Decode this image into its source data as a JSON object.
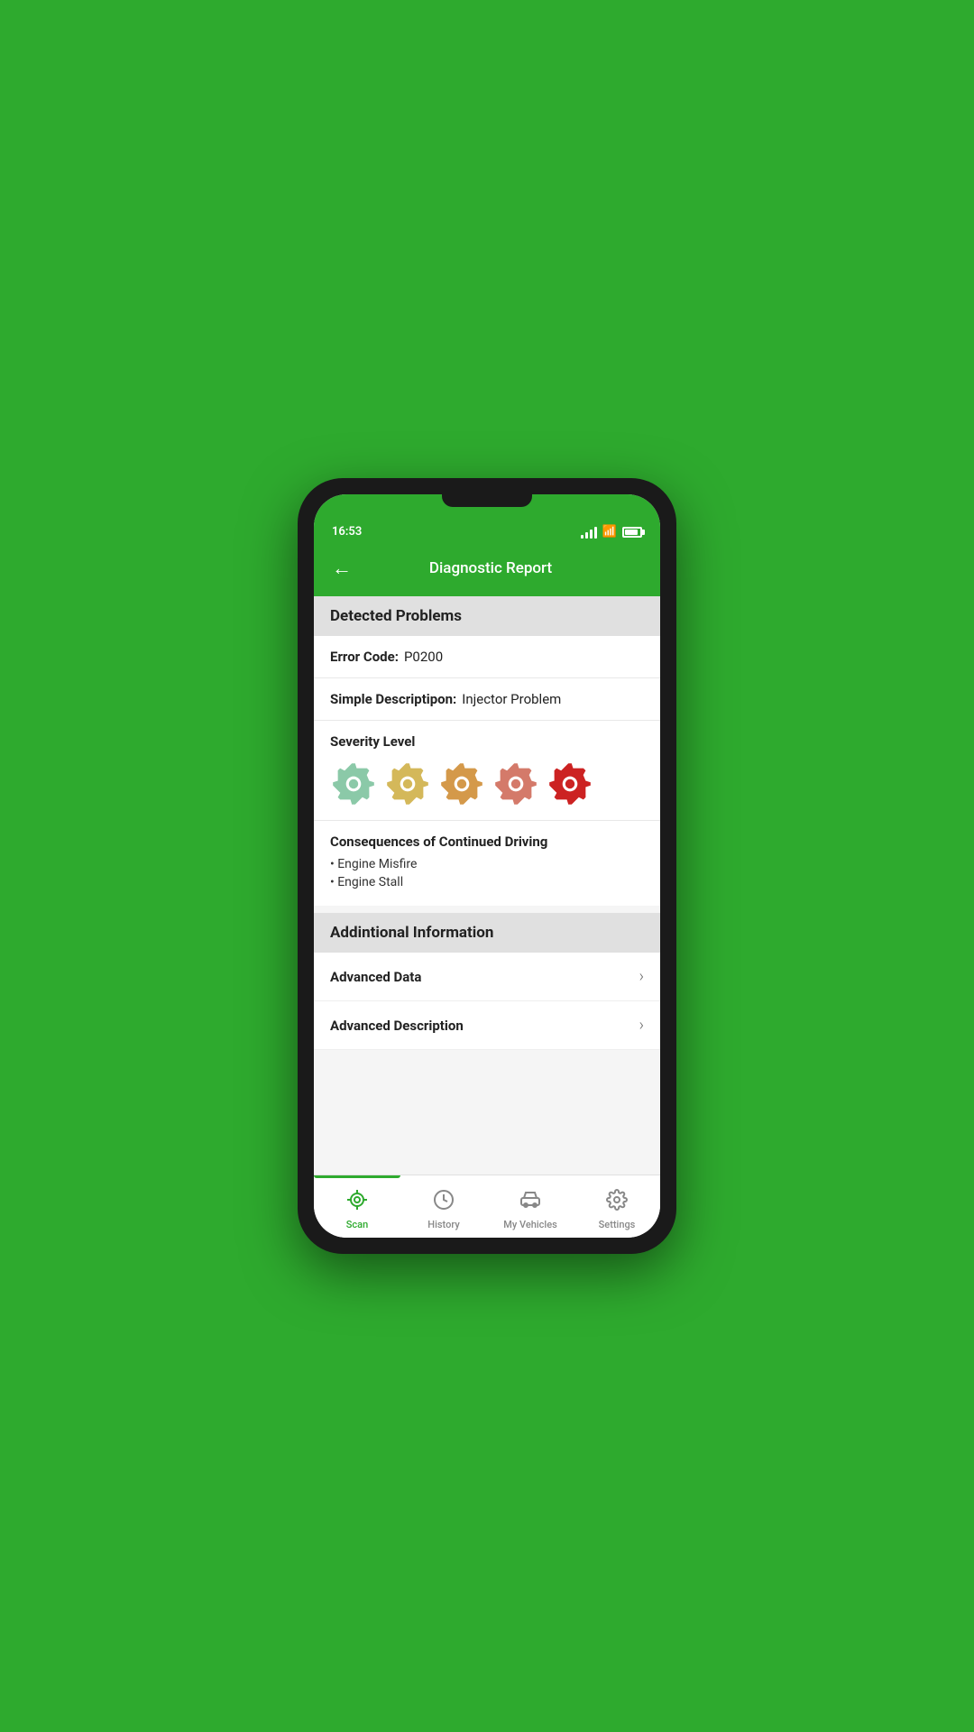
{
  "status_bar": {
    "time": "16:53",
    "signal_bars": [
      4,
      7,
      10,
      13,
      15
    ],
    "battery_level": 85
  },
  "header": {
    "title": "Diagnostic Report",
    "back_label": "←"
  },
  "detected_problems": {
    "section_title": "Detected Problems",
    "error_code_label": "Error Code:",
    "error_code_value": "P0200",
    "simple_desc_label": "Simple Descriptipon:",
    "simple_desc_value": "Injector Problem",
    "severity_label": "Severity Level",
    "severity_levels": [
      {
        "color": "#8bc9a8",
        "active": false
      },
      {
        "color": "#d4b85a",
        "active": false
      },
      {
        "color": "#d4994a",
        "active": false
      },
      {
        "color": "#d47a6a",
        "active": false
      },
      {
        "color": "#cc2222",
        "active": true
      }
    ],
    "consequences_title": "Consequences of Continued Driving",
    "consequences": [
      "Engine Misfire",
      "Engine Stall"
    ]
  },
  "additional_information": {
    "section_title": "Addintional Information",
    "items": [
      {
        "label": "Advanced Data",
        "id": "advanced-data"
      },
      {
        "label": "Advanced Description",
        "id": "advanced-description"
      }
    ]
  },
  "bottom_nav": {
    "items": [
      {
        "id": "scan",
        "label": "Scan",
        "icon": "⊙",
        "active": true
      },
      {
        "id": "history",
        "label": "History",
        "icon": "🕐",
        "active": false
      },
      {
        "id": "my-vehicles",
        "label": "My Vehicles",
        "icon": "🚗",
        "active": false
      },
      {
        "id": "settings",
        "label": "Settings",
        "icon": "⚙",
        "active": false
      }
    ]
  }
}
